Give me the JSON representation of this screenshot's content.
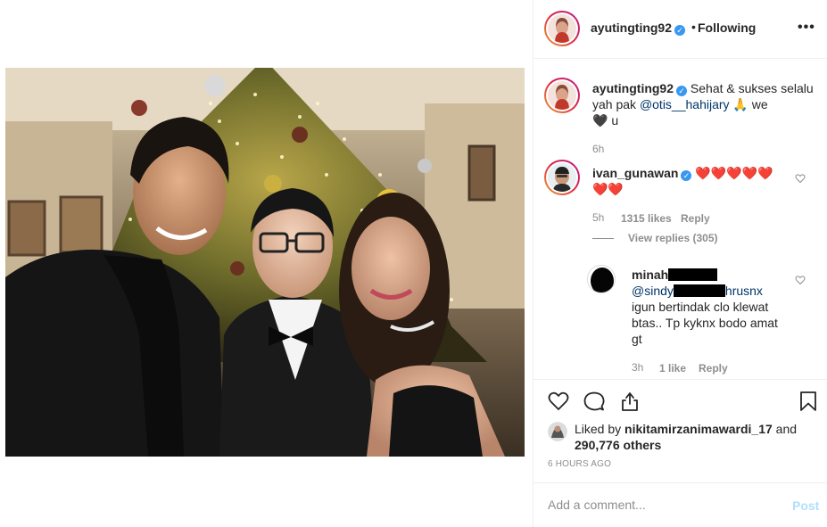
{
  "post": {
    "photo_alt": "Three people posing in front of a decorated Christmas tree"
  },
  "header": {
    "username": "ayutingting92",
    "dot": "•",
    "follow_label": "Following",
    "more_label": "•••"
  },
  "caption": {
    "username": "ayutingting92",
    "text_part1": "Sehat & sukses selalu yah pak ",
    "mention": "@otis__hahijary",
    "text_part2": " 🙏 we ",
    "text_part3": "🖤 u",
    "time": "6h"
  },
  "comments": [
    {
      "username": "ivan_gunawan",
      "hearts_line1": "❤️❤️❤️❤️❤️",
      "hearts_line2": "❤️❤️",
      "time": "5h",
      "likes": "1315 likes",
      "reply_label": "Reply",
      "view_replies": "View replies (305)"
    }
  ],
  "reply": {
    "username_visible": "minah",
    "mention_visible": "@sindy",
    "mention_tail": "hrusnx",
    "text": "igun bertindak clo klewat btas.. Tp kyknx bodo amat gt",
    "time": "3h",
    "likes": "1 like",
    "reply_label": "Reply"
  },
  "likes": {
    "liked_by_prefix": "Liked by ",
    "liked_by_user": "nikitamirzanimawardi_17",
    "and_label": " and",
    "others": "290,776 others"
  },
  "timestamp": "6 HOURS AGO",
  "add_comment": {
    "placeholder": "Add a comment...",
    "post_label": "Post"
  },
  "colors": {
    "accent_blue": "#3897f0",
    "post_disabled": "#b2dffc",
    "mention": "#003569",
    "heart_red": "#ed4956"
  }
}
